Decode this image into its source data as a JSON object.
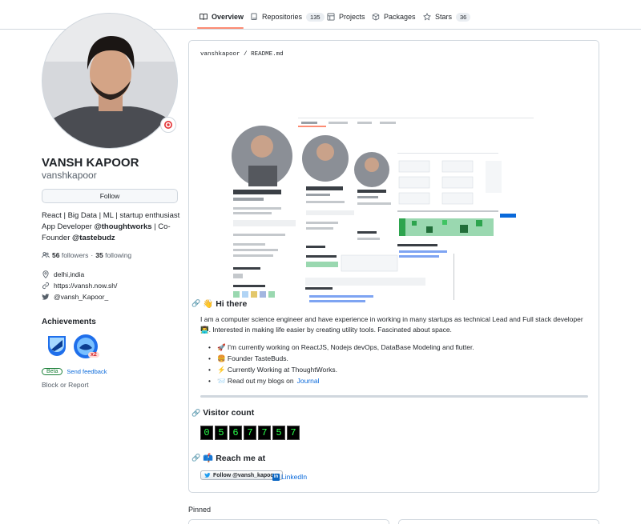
{
  "nav": {
    "tabs": [
      {
        "label": "Overview",
        "icon": "book-icon",
        "active": true
      },
      {
        "label": "Repositories",
        "icon": "repo-icon",
        "count": "135"
      },
      {
        "label": "Projects",
        "icon": "table-icon"
      },
      {
        "label": "Packages",
        "icon": "package-icon"
      },
      {
        "label": "Stars",
        "icon": "star-icon",
        "count": "36"
      }
    ]
  },
  "profile": {
    "full_name": "VANSH KAPOOR",
    "username": "vanshkapoor",
    "follow_label": "Follow",
    "bio_line1": "React | Big Data | ML | startup enthusiast",
    "bio_line2_prefix": "App Developer ",
    "bio_org1": "@thoughtworks",
    "bio_line2_suffix": " | Co-",
    "bio_line3_prefix": "Founder ",
    "bio_org2": "@tastebudz",
    "followers_count": "56",
    "followers_label": "followers",
    "separator": "·",
    "following_count": "35",
    "following_label": "following",
    "location": "delhi,india",
    "website": "https://vansh.now.sh/",
    "twitter": "@vansh_Kapoor_"
  },
  "achievements": {
    "title": "Achievements",
    "badge_multiplier": "x2",
    "beta_label": "Beta",
    "feedback_label": "Send feedback",
    "block_label": "Block or Report"
  },
  "readme": {
    "path_user": "vanshkapoor",
    "path_sep": "/",
    "path_file": "README.md",
    "hi_heading": "👋 Hi there",
    "intro_text": "I am a computer science engineer and have experience in working in many startups as technical Lead and Full stack developer👨‍💻. Interested in making life easier by creating utility tools. Fascinated about space.",
    "list": [
      {
        "text": "🚀 I'm currently working on ReactJS, Nodejs devOps, DataBase Modeling and flutter."
      },
      {
        "text": "🍔 Founder TasteBuds."
      },
      {
        "text": "⚡ Currently Working at ThoughtWorks."
      },
      {
        "text": "📨 Read out my blogs on ",
        "link": "Journal"
      }
    ],
    "visitor_heading": "Visitor count",
    "visitor_digits": [
      "0",
      "5",
      "6",
      "7",
      "7",
      "5",
      "7"
    ],
    "reach_heading": "📫 Reach me at",
    "twitter_follow": "Follow @vansh_kapoor_",
    "linkedin_label": "LinkedIn"
  },
  "pinned": {
    "title": "Pinned"
  }
}
